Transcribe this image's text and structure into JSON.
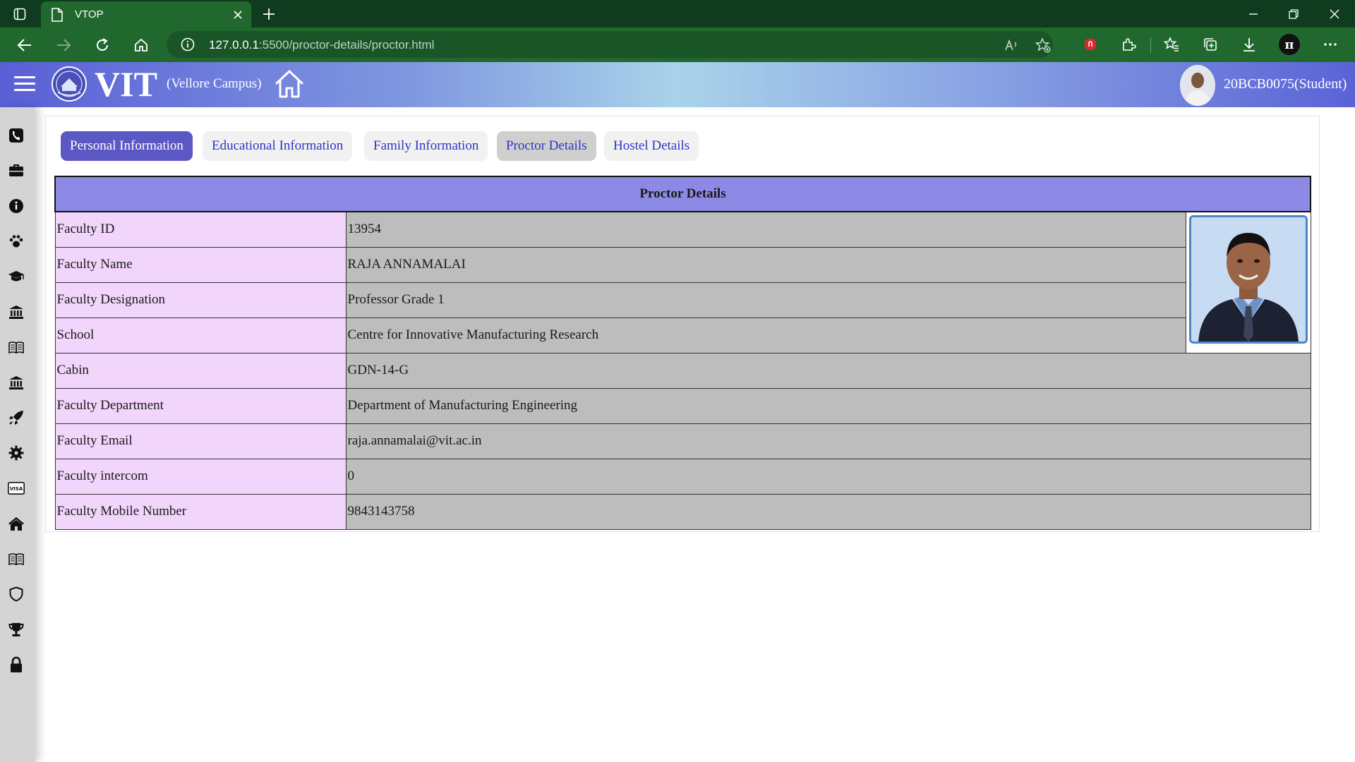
{
  "browser": {
    "tab_title": "VTOP",
    "url_host": "127.0.0.1",
    "url_path": ":5500/proctor-details/proctor.html"
  },
  "header": {
    "logo_text": "VIT",
    "campus": "(Vellore Campus)",
    "user": "20BCB0075(Student)"
  },
  "tabs": [
    {
      "label": "Personal Information",
      "state": "active"
    },
    {
      "label": "Educational Information",
      "state": "normal"
    },
    {
      "label": "Family Information",
      "state": "normal"
    },
    {
      "label": "Proctor Details",
      "state": "hover"
    },
    {
      "label": "Hostel Details",
      "state": "normal"
    }
  ],
  "table": {
    "title": "Proctor Details",
    "rows": [
      {
        "label": "Faculty ID",
        "value": "13954"
      },
      {
        "label": "Faculty Name",
        "value": "RAJA ANNAMALAI"
      },
      {
        "label": "Faculty Designation",
        "value": "Professor Grade 1"
      },
      {
        "label": "School",
        "value": "Centre for Innovative Manufacturing Research"
      },
      {
        "label": "Cabin",
        "value": "GDN-14-G"
      },
      {
        "label": "Faculty Department",
        "value": "Department of Manufacturing Engineering"
      },
      {
        "label": "Faculty Email",
        "value": "raja.annamalai@vit.ac.in"
      },
      {
        "label": "Faculty intercom",
        "value": "0"
      },
      {
        "label": "Faculty Mobile Number",
        "value": "9843143758"
      }
    ]
  },
  "sidebar_icons": [
    "phone-icon",
    "briefcase-icon",
    "info-icon",
    "paw-icon",
    "graduation-cap-icon",
    "bank-icon",
    "book-icon",
    "bank-icon",
    "rocket-icon",
    "gear-icon",
    "visa-card-icon",
    "home-icon",
    "book-icon",
    "shield-icon",
    "trophy-icon",
    "lock-icon"
  ],
  "colors": {
    "browser_dark": "#0f3b1e",
    "browser_toolbar": "#21682f",
    "active_tab": "#5b57c4",
    "tab_text": "#2d35c4",
    "table_header": "#8d8ae6",
    "label_cell": "#f1d5fb",
    "value_cell": "#bdbdbd"
  }
}
